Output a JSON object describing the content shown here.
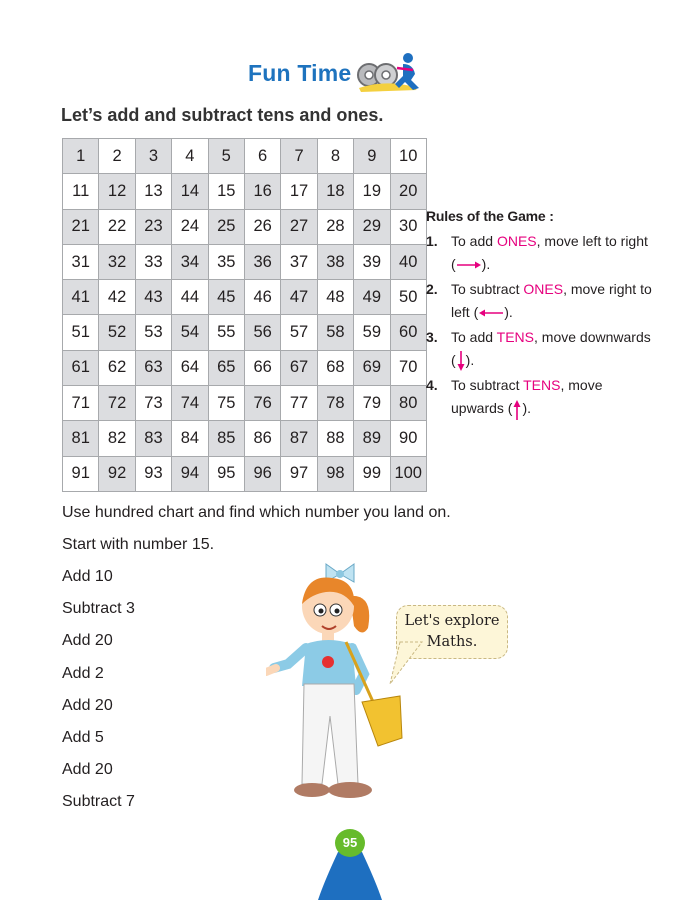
{
  "header": {
    "title": "Fun Time"
  },
  "subtitle": "Let’s add and subtract tens and ones.",
  "chart": {
    "rows": [
      [
        "1",
        "2",
        "3",
        "4",
        "5",
        "6",
        "7",
        "8",
        "9",
        "10"
      ],
      [
        "11",
        "12",
        "13",
        "14",
        "15",
        "16",
        "17",
        "18",
        "19",
        "20"
      ],
      [
        "21",
        "22",
        "23",
        "24",
        "25",
        "26",
        "27",
        "28",
        "29",
        "30"
      ],
      [
        "31",
        "32",
        "33",
        "34",
        "35",
        "36",
        "37",
        "38",
        "39",
        "40"
      ],
      [
        "41",
        "42",
        "43",
        "44",
        "45",
        "46",
        "47",
        "48",
        "49",
        "50"
      ],
      [
        "51",
        "52",
        "53",
        "54",
        "55",
        "56",
        "57",
        "58",
        "59",
        "60"
      ],
      [
        "61",
        "62",
        "63",
        "64",
        "65",
        "66",
        "67",
        "68",
        "69",
        "70"
      ],
      [
        "71",
        "72",
        "73",
        "74",
        "75",
        "76",
        "77",
        "78",
        "79",
        "80"
      ],
      [
        "81",
        "82",
        "83",
        "84",
        "85",
        "86",
        "87",
        "88",
        "89",
        "90"
      ],
      [
        "91",
        "92",
        "93",
        "94",
        "95",
        "96",
        "97",
        "98",
        "99",
        "100"
      ]
    ]
  },
  "rules": {
    "title": "Rules of the Game :",
    "items": [
      {
        "num": "1.",
        "pre": "To add ",
        "key": "ONES",
        "mid": ", move left to right (",
        "post": ")."
      },
      {
        "num": "2.",
        "pre": "To subtract ",
        "key": "ONES",
        "mid": ", move right to left (",
        "post": ")."
      },
      {
        "num": "3.",
        "pre": "To add ",
        "key": "TENS",
        "mid": ", move downwards (",
        "post": ")."
      },
      {
        "num": "4.",
        "pre": "To subtract ",
        "key": "TENS",
        "mid": ", move upwards (",
        "post": ")."
      }
    ],
    "accent_color": "#e6007e"
  },
  "instructions": {
    "line1": "Use hundred chart and find which number you land on.",
    "line2": "Start with number 15.",
    "steps": [
      "Add 10",
      "Subtract 3",
      "Add 20",
      "Add 2",
      "Add 20",
      "Add 5",
      "Add 20",
      "Subtract 7"
    ]
  },
  "speech_bubble": {
    "line1": "Let's explore",
    "line2": "Maths."
  },
  "page_number": "95",
  "colors": {
    "title_blue": "#1e73be",
    "shade_gray": "#dcdde0",
    "page_badge_green": "#66bb2b",
    "mount_blue": "#1e6fc0"
  }
}
